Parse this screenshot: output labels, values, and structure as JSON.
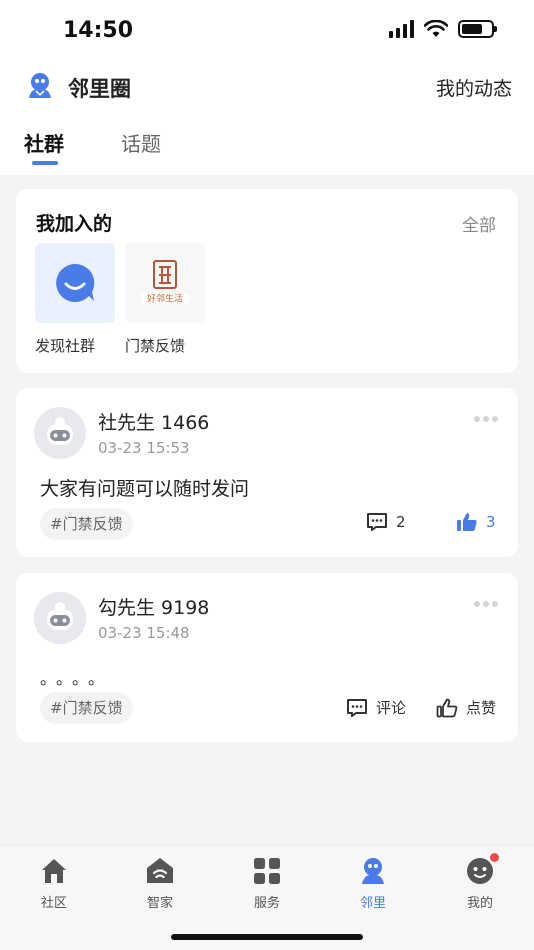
{
  "status_bar": {
    "time": "14:50"
  },
  "header": {
    "title": "邻里圈",
    "my_feed": "我的动态"
  },
  "tabs": [
    {
      "label": "社群"
    },
    {
      "label": "话题"
    }
  ],
  "joined": {
    "title": "我加入的",
    "all_label": "全部",
    "groups": [
      {
        "name": "发现社群"
      },
      {
        "name": "门禁反馈"
      }
    ],
    "logo_text": "好邻生活"
  },
  "posts": [
    {
      "user": "社先生 1466",
      "time": "03-23 15:53",
      "content": "大家有问题可以随时发问",
      "tag": "#门禁反馈",
      "comments": "2",
      "likes": "3"
    },
    {
      "user": "勾先生 9198",
      "time": "03-23 15:48",
      "content": "。。。。",
      "tag": "#门禁反馈",
      "comment_label": "评论",
      "like_label": "点赞"
    }
  ],
  "bottom_nav": [
    {
      "label": "社区",
      "icon": "home-icon"
    },
    {
      "label": "智家",
      "icon": "smart-home-icon"
    },
    {
      "label": "服务",
      "icon": "grid-icon"
    },
    {
      "label": "邻里",
      "icon": "neighbor-icon",
      "active": true
    },
    {
      "label": "我的",
      "icon": "profile-icon"
    }
  ],
  "colors": {
    "accent": "#4a7ce8",
    "badge": "#ef4848",
    "background": "#f4f4f6"
  }
}
